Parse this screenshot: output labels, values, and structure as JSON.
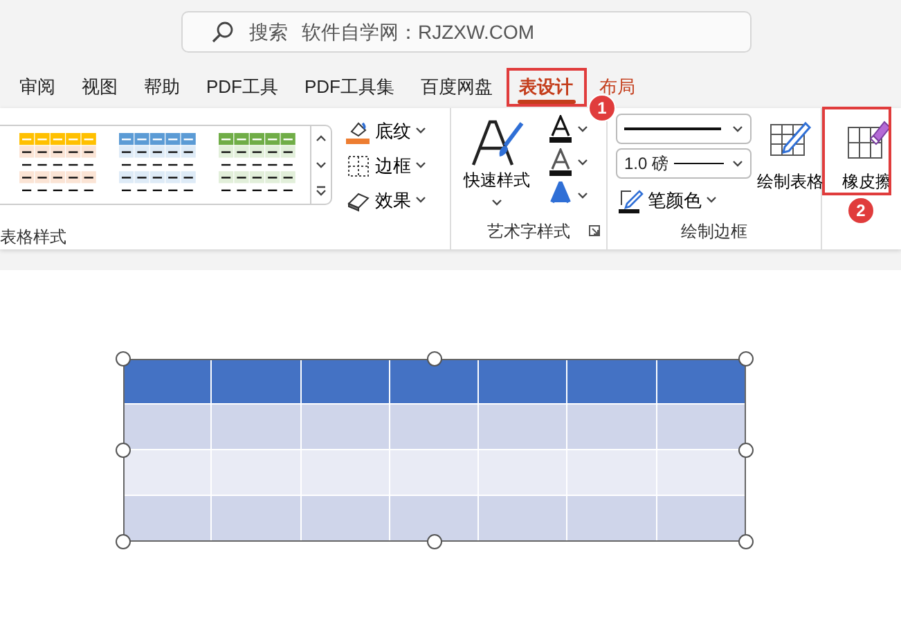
{
  "search": {
    "icon_label": "搜索",
    "text": "软件自学网：RJZXW.COM"
  },
  "tabs": [
    {
      "label": "审阅",
      "selected": false,
      "contextual": false
    },
    {
      "label": "视图",
      "selected": false,
      "contextual": false
    },
    {
      "label": "帮助",
      "selected": false,
      "contextual": false
    },
    {
      "label": "PDF工具",
      "selected": false,
      "contextual": false
    },
    {
      "label": "PDF工具集",
      "selected": false,
      "contextual": false
    },
    {
      "label": "百度网盘",
      "selected": false,
      "contextual": false
    },
    {
      "label": "表设计",
      "selected": true,
      "contextual": true
    },
    {
      "label": "布局",
      "selected": false,
      "contextual": true
    }
  ],
  "ribbon": {
    "table_styles": {
      "label": "表格样式"
    },
    "shading_buttons": [
      {
        "kind": "shading",
        "label": "底纹"
      },
      {
        "kind": "borders",
        "label": "边框"
      },
      {
        "kind": "effects",
        "label": "效果"
      }
    ],
    "wordart": {
      "quick_styles": "快速样式",
      "label": "艺术字样式"
    },
    "draw_borders": {
      "line_weight": "1.0 磅",
      "pen_color": "笔颜色",
      "draw_table": "绘制表格",
      "label": "绘制边框"
    },
    "eraser": {
      "label": "橡皮擦"
    }
  },
  "annotations": [
    {
      "label": "1"
    },
    {
      "label": "2"
    }
  ],
  "table": {
    "selected": true,
    "rows": [
      {
        "kind": "header"
      },
      {
        "kind": "band"
      },
      {
        "kind": "plain"
      },
      {
        "kind": "band"
      }
    ]
  }
}
